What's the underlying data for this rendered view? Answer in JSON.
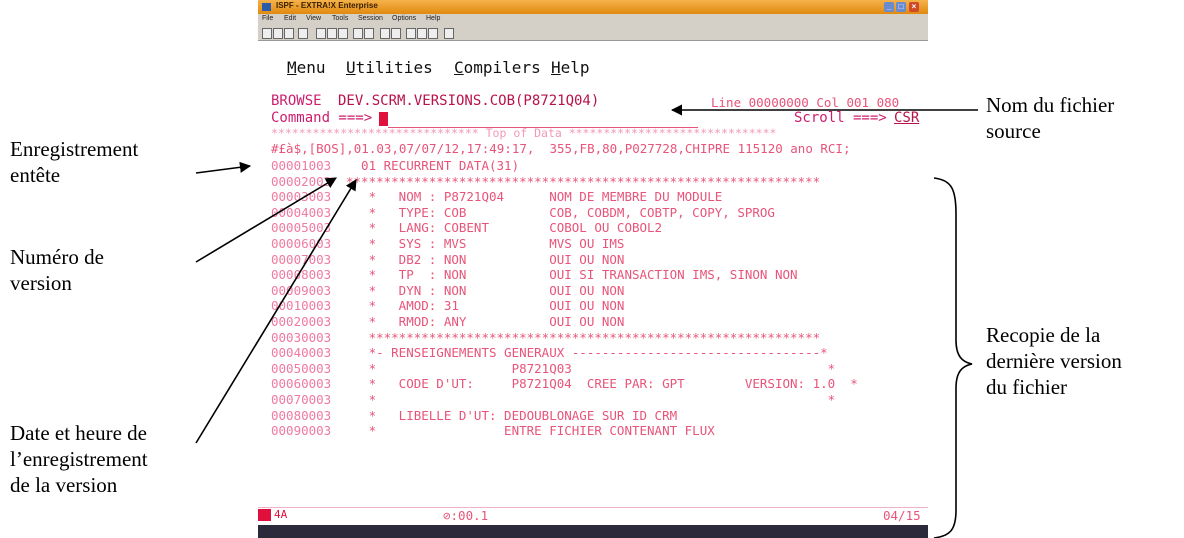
{
  "window": {
    "title": "ISPF - EXTRA!X Enterprise",
    "menu": [
      "File",
      "Edit",
      "View",
      "Tools",
      "Session",
      "Options",
      "Help"
    ]
  },
  "ispf_menu": [
    {
      "label": "Menu",
      "key": "M"
    },
    {
      "label": "Utilities",
      "key": "U"
    },
    {
      "label": "Compilers",
      "key": "C"
    },
    {
      "label": "Help",
      "key": "H"
    }
  ],
  "browse": {
    "mode": "BROWSE",
    "dataset": "DEV.SCRM.VERSIONS.COB(P8721Q04)",
    "line_col": "Line 00000000 Col 001 080",
    "command_label": "Command ===>",
    "scroll_label": "Scroll ===>",
    "scroll_value": "CSR"
  },
  "top_of_data": "****************************** Top of Data ******************************",
  "header_record": "#£à$,[BOS],01.03,07/07/12,17:49:17,  355,FB,80,P027728,CHIPRE 115120 ano RCI;",
  "rows": [
    {
      "num": "00001003",
      "text": "  01 RECURRENT DATA(31)"
    },
    {
      "num": "00002003",
      "text": "***************************************************************"
    },
    {
      "num": "00003003",
      "text": "   *   NOM : P8721Q04      NOM DE MEMBRE DU MODULE"
    },
    {
      "num": "00004003",
      "text": "   *   TYPE: COB           COB, COBDM, COBTP, COPY, SPROG"
    },
    {
      "num": "00005003",
      "text": "   *   LANG: COBENT        COBOL OU COBOL2"
    },
    {
      "num": "00006003",
      "text": "   *   SYS : MVS           MVS OU IMS"
    },
    {
      "num": "00007003",
      "text": "   *   DB2 : NON           OUI OU NON"
    },
    {
      "num": "00008003",
      "text": "   *   TP  : NON           OUI SI TRANSACTION IMS, SINON NON"
    },
    {
      "num": "00009003",
      "text": "   *   DYN : NON           OUI OU NON"
    },
    {
      "num": "00010003",
      "text": "   *   AMOD: 31            OUI OU NON"
    },
    {
      "num": "00020003",
      "text": "   *   RMOD: ANY           OUI OU NON"
    },
    {
      "num": "00030003",
      "text": "   ************************************************************"
    },
    {
      "num": "00040003",
      "text": "   *- RENSEIGNEMENTS GENERAUX ---------------------------------*"
    },
    {
      "num": "00050003",
      "text": "   *                  P8721Q03                                  *"
    },
    {
      "num": "00060003",
      "text": "   *   CODE D'UT:     P8721Q04  CREE PAR: GPT        VERSION: 1.0  *"
    },
    {
      "num": "00070003",
      "text": "   *                                                            *"
    },
    {
      "num": "00080003",
      "text": "   *   LIBELLE D'UT: DEDOUBLONAGE SUR ID CRM"
    },
    {
      "num": "00090003",
      "text": "   *                 ENTRE FICHIER CONTENANT FLUX"
    }
  ],
  "status": {
    "indicator": "4A",
    "time": "⊘:00.1",
    "position": "04/15"
  },
  "annotations": {
    "nom_fichier": [
      "Nom du fichier",
      "source"
    ],
    "enregistrement": [
      "Enregistrement",
      "entête"
    ],
    "numero": [
      "Numéro de",
      "version"
    ],
    "date": [
      "Date et heure de",
      "l’enregistrement",
      "de la version"
    ],
    "recopie": [
      "Recopie de la",
      "dernière version",
      "du fichier"
    ]
  }
}
